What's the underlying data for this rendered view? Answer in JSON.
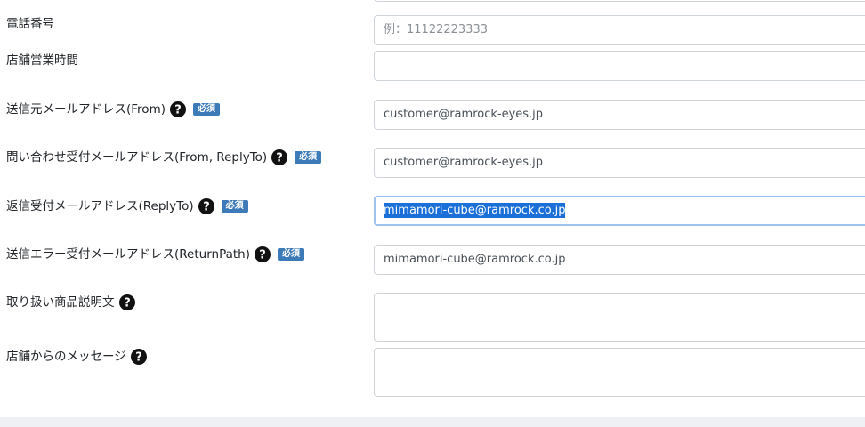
{
  "form": {
    "phone": {
      "label": "電話番号",
      "placeholder": "例：11122223333"
    },
    "hours": {
      "label": "店舗営業時間",
      "value": ""
    },
    "from_email": {
      "label": "送信元メールアドレス(From)",
      "required_badge": "必須",
      "value": "customer@ramrock-eyes.jp"
    },
    "inquiry_email": {
      "label": "問い合わせ受付メールアドレス(From, ReplyTo)",
      "required_badge": "必須",
      "value": "customer@ramrock-eyes.jp"
    },
    "reply_email": {
      "label": "返信受付メールアドレス(ReplyTo)",
      "required_badge": "必須",
      "value": "mimamori-cube@ramrock.co.jp"
    },
    "error_email": {
      "label": "送信エラー受付メールアドレス(ReturnPath)",
      "required_badge": "必須",
      "value": "mimamori-cube@ramrock.co.jp"
    },
    "product_description": {
      "label": "取り扱い商品説明文",
      "value": ""
    },
    "store_message": {
      "label": "店舗からのメッセージ",
      "value": ""
    }
  },
  "colors": {
    "badge": "#3d7ab8",
    "selection": "#1a6fd8",
    "focus_border": "#9fc2ee"
  },
  "icons": {
    "help": "question-circle-icon"
  }
}
